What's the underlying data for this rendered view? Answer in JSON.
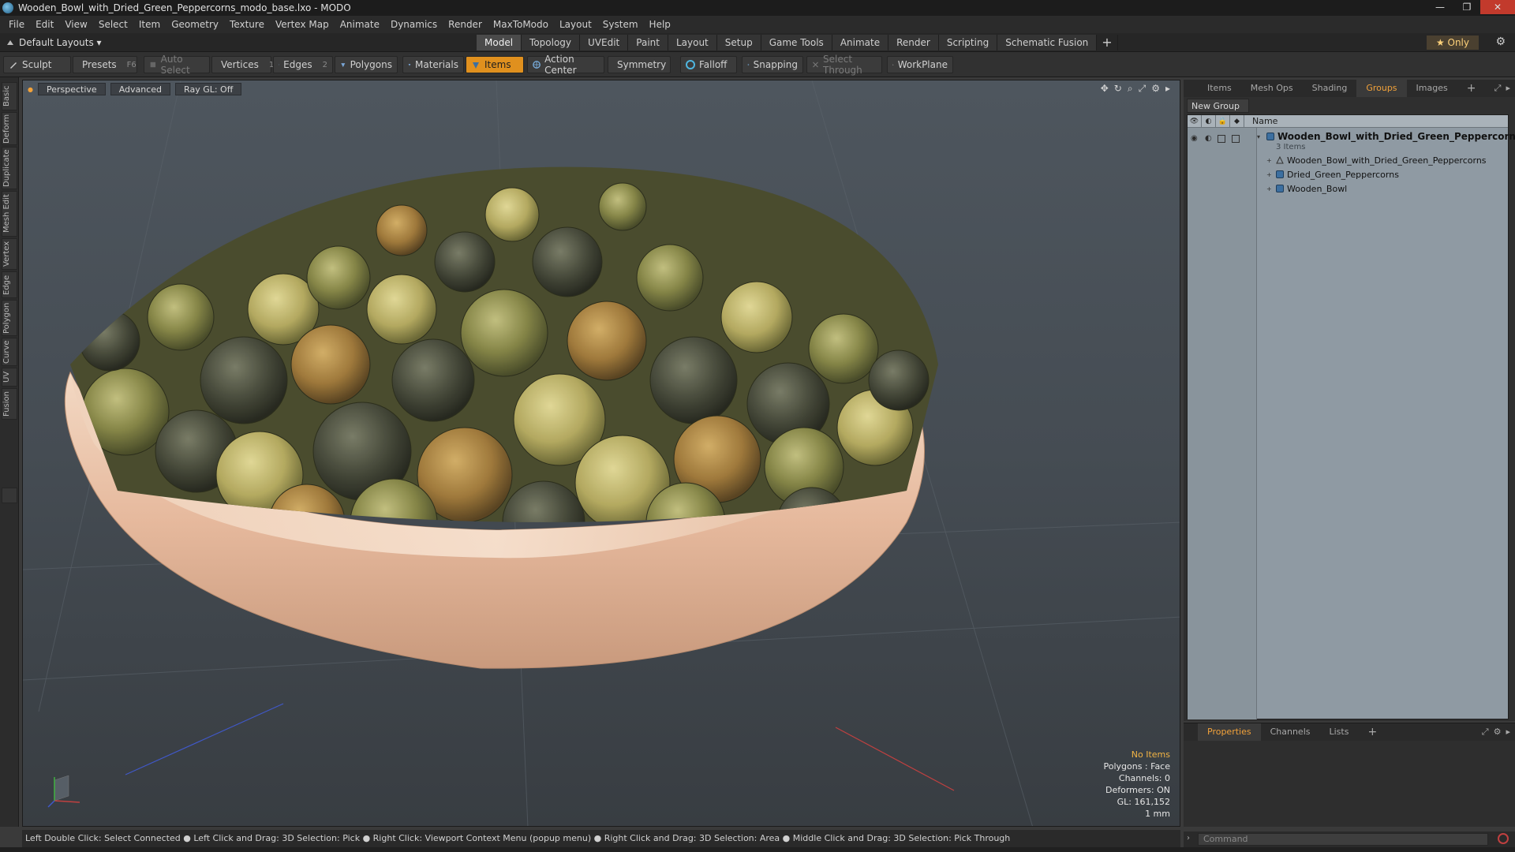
{
  "window": {
    "title": "Wooden_Bowl_with_Dried_Green_Peppercorns_modo_base.lxo - MODO",
    "minimize_glyph": "—",
    "restore_glyph": "❐",
    "close_glyph": "✕"
  },
  "menu": [
    "File",
    "Edit",
    "View",
    "Select",
    "Item",
    "Geometry",
    "Texture",
    "Vertex Map",
    "Animate",
    "Dynamics",
    "Render",
    "MaxToModo",
    "Layout",
    "System",
    "Help"
  ],
  "layout_bar": {
    "layout_selector": "Default Layouts ▾",
    "tabs": [
      "Model",
      "Topology",
      "UVEdit",
      "Paint",
      "Layout",
      "Setup",
      "Game Tools",
      "Animate",
      "Render",
      "Scripting",
      "Schematic Fusion"
    ],
    "active_tab": "Model",
    "add_tab": "+",
    "only_button": "★  Only"
  },
  "toolbar": {
    "sculpt": "Sculpt",
    "presets": "Presets",
    "presets_key": "F6",
    "auto_select": "Auto Select",
    "vertices": "Vertices",
    "vertices_count": "1",
    "edges": "Edges",
    "edges_count": "2",
    "polygons": "Polygons",
    "materials": "Materials",
    "items": "Items",
    "action_center": "Action Center",
    "symmetry": "Symmetry",
    "falloff": "Falloff",
    "snapping": "Snapping",
    "select_through": "Select Through",
    "workplane": "WorkPlane"
  },
  "left_tabs": [
    "Basic",
    "Deform",
    "Duplicate",
    "Mesh Edit",
    "Vertex",
    "Edge",
    "Polygon",
    "Curve",
    "UV",
    "Fusion"
  ],
  "viewport": {
    "view_mode": "Perspective",
    "shading": "Advanced",
    "raygl": "Ray GL: Off",
    "info": {
      "items": "No Items",
      "polygons": "Polygons : Face",
      "channels": "Channels: 0",
      "deformers": "Deformers: ON",
      "gl": "GL: 161,152",
      "scale": "1 mm"
    }
  },
  "status_bar": "Left Double Click: Select Connected ● Left Click and Drag: 3D Selection: Pick ● Right Click: Viewport Context Menu (popup menu) ● Right Click and Drag: 3D Selection: Area ● Middle Click and Drag: 3D Selection: Pick Through",
  "right_panel": {
    "tabs": [
      "Items",
      "Mesh Ops",
      "Shading",
      "Groups",
      "Images"
    ],
    "active_tab": "Groups",
    "add_tab": "+",
    "new_group": "New Group",
    "name_header": "Name",
    "tree": {
      "root": "Wooden_Bowl_with_Dried_Green_Peppercorn...",
      "root_sub": "3 Items",
      "children": [
        "Wooden_Bowl_with_Dried_Green_Peppercorns",
        "Dried_Green_Peppercorns",
        "Wooden_Bowl"
      ]
    }
  },
  "properties_panel": {
    "tabs": [
      "Properties",
      "Channels",
      "Lists"
    ],
    "active_tab": "Properties",
    "add_tab": "+"
  },
  "command": {
    "placeholder": "Command"
  },
  "colors": {
    "accent": "#f2a23a",
    "active_tool": "#e0901e",
    "info_highlight": "#f2b445"
  }
}
